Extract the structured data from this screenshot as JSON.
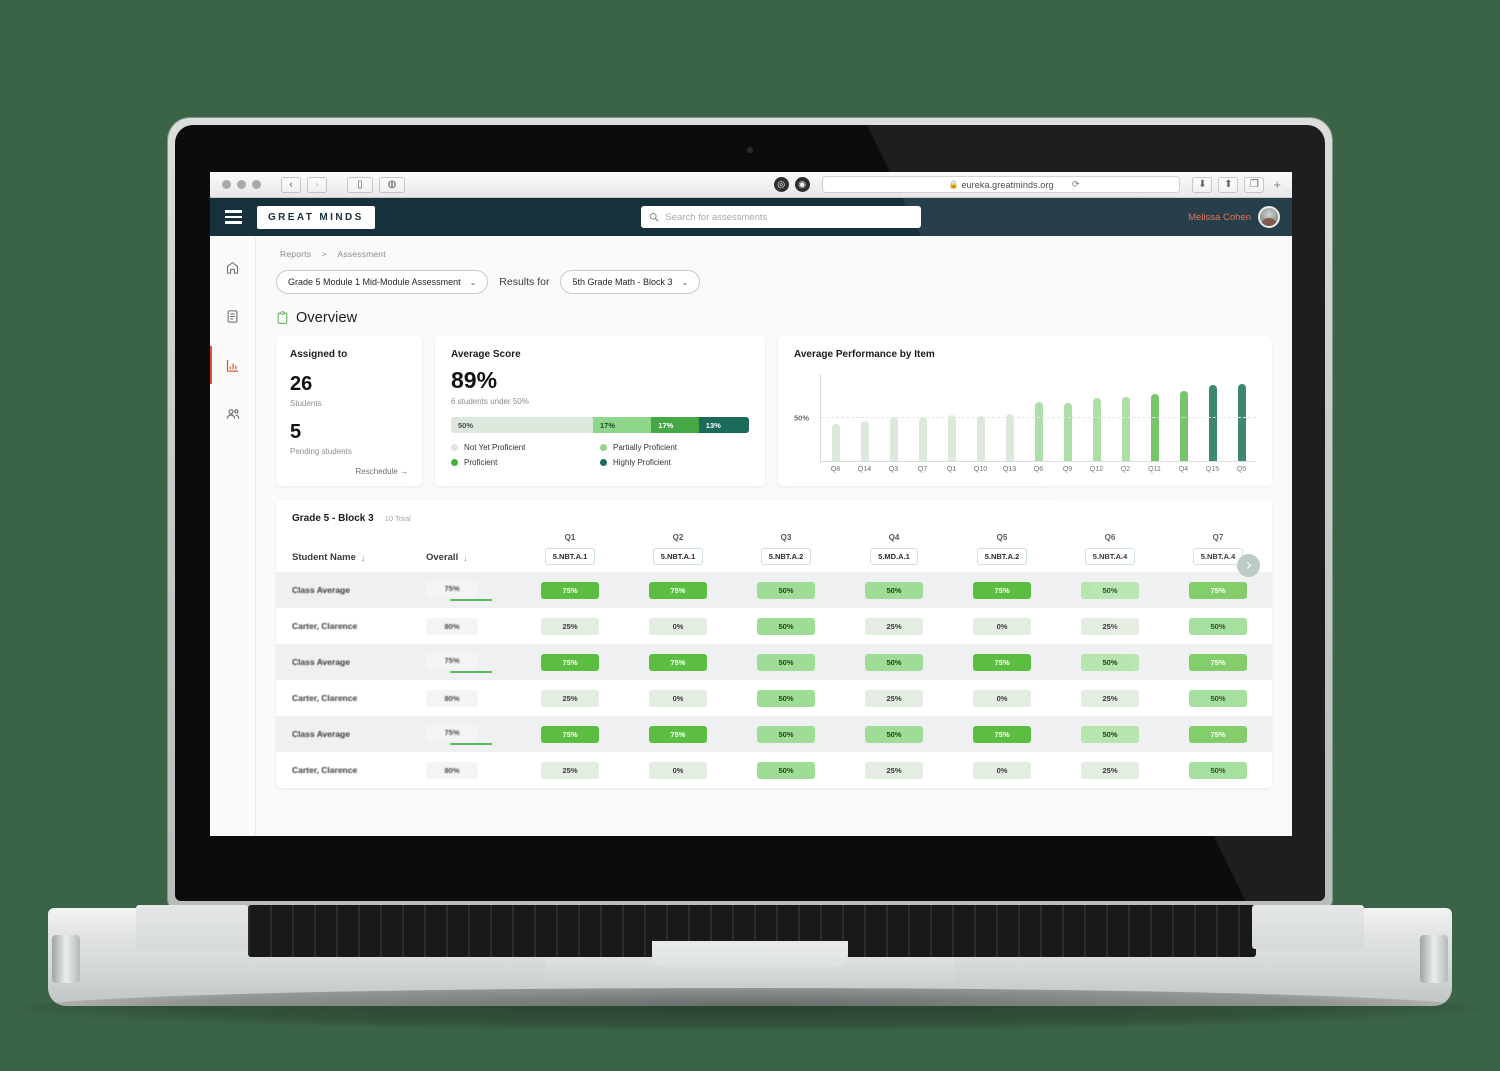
{
  "browser": {
    "url": "eureka.greatminds.org",
    "lock_icon": "lock-icon",
    "back_icon": "chevron-left-icon",
    "forward_icon": "chevron-right-icon",
    "sidebar_icon": "sidebar-toggle-icon",
    "compass_icon": "compass-icon",
    "reload_icon": "reload-icon",
    "download_icon": "download-icon",
    "share_icon": "share-icon",
    "tabs_icon": "tabs-icon",
    "new_tab_icon": "plus-icon"
  },
  "header": {
    "logo": "GREAT MINDS",
    "menu_icon": "hamburger-icon",
    "search": {
      "placeholder": "Search for assessments",
      "value": "",
      "icon": "search-icon"
    },
    "user_name": "Melissa Cohen"
  },
  "sidebar": {
    "items": [
      {
        "name": "home",
        "icon": "home-icon",
        "active": false
      },
      {
        "name": "reports",
        "icon": "document-icon",
        "active": false
      },
      {
        "name": "analytics",
        "icon": "bar-chart-icon",
        "active": true
      },
      {
        "name": "students",
        "icon": "people-icon",
        "active": false
      }
    ]
  },
  "breadcrumb": {
    "root": "Reports",
    "separator": ">",
    "current": "Assessment"
  },
  "filters": {
    "assessment": "Grade 5 Module 1 Mid-Module Assessment",
    "results_for_label": "Results for",
    "class": "5th Grade Math - Block 3",
    "chevron_icon": "chevron-down-icon"
  },
  "overview": {
    "icon": "clipboard-icon",
    "title": "Overview",
    "assigned": {
      "title": "Assigned to",
      "students_count": "26",
      "students_label": "Students",
      "pending_count": "5",
      "pending_label": "Pending students",
      "reschedule": "Reschedule →"
    },
    "average_score": {
      "title": "Average Score",
      "value": "89%",
      "subtitle": "6 students under 50%",
      "segments": [
        {
          "label": "50%",
          "pct": 50,
          "color": "#dde8dc",
          "text_color": "#4a4a4a"
        },
        {
          "label": "17%",
          "pct": 19,
          "color": "#8ed68a",
          "text_color": "#1f4a23"
        },
        {
          "label": "17%",
          "pct": 15,
          "color": "#45a845",
          "text_color": "#ffffff"
        },
        {
          "label": "13%",
          "pct": 16,
          "color": "#1a6b5c",
          "text_color": "#ffffff"
        }
      ],
      "legend": [
        {
          "label": "Not Yet Proficient",
          "color": "#dde8dc"
        },
        {
          "label": "Partially Proficient",
          "color": "#8ed68a"
        },
        {
          "label": "Proficient",
          "color": "#45b03c"
        },
        {
          "label": "Highly Proficient",
          "color": "#1a6b5c"
        }
      ]
    }
  },
  "chart_data": {
    "type": "bar",
    "title": "Average Performance by Item",
    "xlabel": "",
    "ylabel": "",
    "ylim": [
      0,
      100
    ],
    "grid": true,
    "gridlines": [
      50
    ],
    "ytick_labels": [
      "50%"
    ],
    "legend": "none",
    "categories": [
      "Q8",
      "Q14",
      "Q3",
      "Q7",
      "Q1",
      "Q10",
      "Q13",
      "Q6",
      "Q9",
      "Q12",
      "Q2",
      "Q11",
      "Q4",
      "Q15",
      "Q5"
    ],
    "values": [
      43,
      46,
      51,
      51,
      53,
      52,
      54,
      68,
      67,
      73,
      74,
      77,
      81,
      87,
      89
    ],
    "bar_colors": [
      "#dde8dc",
      "#dde8dc",
      "#dde8dc",
      "#dde8dc",
      "#dde8dc",
      "#dde8dc",
      "#dde8dc",
      "#a7dba1",
      "#a7dba1",
      "#a7dba1",
      "#a7dba1",
      "#6cc05f",
      "#6cc05f",
      "#2e7d68",
      "#2e7d68"
    ]
  },
  "table": {
    "title": "Grade 5 - Block 3",
    "total": "10 Total",
    "scroll_right_icon": "chevron-right-icon",
    "headers": {
      "student_name": "Student Name",
      "overall": "Overall",
      "sort_icon": "arrow-down-icon"
    },
    "columns": [
      {
        "q": "Q1",
        "standard": "5.NBT.A.1"
      },
      {
        "q": "Q2",
        "standard": "5.NBT.A.1"
      },
      {
        "q": "Q3",
        "standard": "5.NBT.A.2"
      },
      {
        "q": "Q4",
        "standard": "5.MD.A.1"
      },
      {
        "q": "Q5",
        "standard": "5.NBT.A.2"
      },
      {
        "q": "Q6",
        "standard": "5.NBT.A.4"
      },
      {
        "q": "Q7",
        "standard": "5.NBT.A.4"
      }
    ],
    "rows": [
      {
        "name": "Class Average",
        "type": "average",
        "overall": "75%",
        "scores": [
          {
            "value": "75%",
            "bg": "#5cbe41",
            "fg": "#ffffff"
          },
          {
            "value": "75%",
            "bg": "#5cbe41",
            "fg": "#ffffff"
          },
          {
            "value": "50%",
            "bg": "#9fdd97",
            "fg": "#27401f"
          },
          {
            "value": "50%",
            "bg": "#9fdd97",
            "fg": "#27401f"
          },
          {
            "value": "75%",
            "bg": "#5cbe41",
            "fg": "#ffffff"
          },
          {
            "value": "50%",
            "bg": "#b6e5ae",
            "fg": "#27401f"
          },
          {
            "value": "75%",
            "bg": "#7ac95f",
            "fg": "#ffffff"
          }
        ]
      },
      {
        "name": "Carter, Clarence",
        "type": "student",
        "overall": "80%",
        "scores": [
          {
            "value": "25%",
            "bg": "#e4ede2",
            "fg": "#3c3c3c"
          },
          {
            "value": "0%",
            "bg": "#e4ede2",
            "fg": "#3c3c3c"
          },
          {
            "value": "50%",
            "bg": "#9fdd97",
            "fg": "#27401f"
          },
          {
            "value": "25%",
            "bg": "#e4ede2",
            "fg": "#3c3c3c"
          },
          {
            "value": "0%",
            "bg": "#e4ede2",
            "fg": "#3c3c3c"
          },
          {
            "value": "25%",
            "bg": "#e4ede2",
            "fg": "#3c3c3c"
          },
          {
            "value": "50%",
            "bg": "#9fdd97",
            "fg": "#27401f"
          }
        ]
      },
      {
        "name": "Class Average",
        "type": "average",
        "overall": "75%",
        "scores": [
          {
            "value": "75%",
            "bg": "#5cbe41",
            "fg": "#ffffff"
          },
          {
            "value": "75%",
            "bg": "#5cbe41",
            "fg": "#ffffff"
          },
          {
            "value": "50%",
            "bg": "#9fdd97",
            "fg": "#27401f"
          },
          {
            "value": "50%",
            "bg": "#9fdd97",
            "fg": "#27401f"
          },
          {
            "value": "75%",
            "bg": "#5cbe41",
            "fg": "#ffffff"
          },
          {
            "value": "50%",
            "bg": "#b6e5ae",
            "fg": "#27401f"
          },
          {
            "value": "75%",
            "bg": "#7ac95f",
            "fg": "#ffffff"
          }
        ]
      },
      {
        "name": "Carter, Clarence",
        "type": "student",
        "overall": "80%",
        "scores": [
          {
            "value": "25%",
            "bg": "#e4ede2",
            "fg": "#3c3c3c"
          },
          {
            "value": "0%",
            "bg": "#e4ede2",
            "fg": "#3c3c3c"
          },
          {
            "value": "50%",
            "bg": "#9fdd97",
            "fg": "#27401f"
          },
          {
            "value": "25%",
            "bg": "#e4ede2",
            "fg": "#3c3c3c"
          },
          {
            "value": "0%",
            "bg": "#e4ede2",
            "fg": "#3c3c3c"
          },
          {
            "value": "25%",
            "bg": "#e4ede2",
            "fg": "#3c3c3c"
          },
          {
            "value": "50%",
            "bg": "#9fdd97",
            "fg": "#27401f"
          }
        ]
      },
      {
        "name": "Class Average",
        "type": "average",
        "overall": "75%",
        "scores": [
          {
            "value": "75%",
            "bg": "#5cbe41",
            "fg": "#ffffff"
          },
          {
            "value": "75%",
            "bg": "#5cbe41",
            "fg": "#ffffff"
          },
          {
            "value": "50%",
            "bg": "#9fdd97",
            "fg": "#27401f"
          },
          {
            "value": "50%",
            "bg": "#9fdd97",
            "fg": "#27401f"
          },
          {
            "value": "75%",
            "bg": "#5cbe41",
            "fg": "#ffffff"
          },
          {
            "value": "50%",
            "bg": "#b6e5ae",
            "fg": "#27401f"
          },
          {
            "value": "75%",
            "bg": "#7ac95f",
            "fg": "#ffffff"
          }
        ]
      },
      {
        "name": "Carter, Clarence",
        "type": "student",
        "overall": "80%",
        "scores": [
          {
            "value": "25%",
            "bg": "#e4ede2",
            "fg": "#3c3c3c"
          },
          {
            "value": "0%",
            "bg": "#e4ede2",
            "fg": "#3c3c3c"
          },
          {
            "value": "50%",
            "bg": "#9fdd97",
            "fg": "#27401f"
          },
          {
            "value": "25%",
            "bg": "#e4ede2",
            "fg": "#3c3c3c"
          },
          {
            "value": "0%",
            "bg": "#e4ede2",
            "fg": "#3c3c3c"
          },
          {
            "value": "25%",
            "bg": "#e4ede2",
            "fg": "#3c3c3c"
          },
          {
            "value": "50%",
            "bg": "#9fdd97",
            "fg": "#27401f"
          }
        ]
      }
    ]
  },
  "colors": {
    "page_background": "#3b6346",
    "app_header": "#16303c",
    "accent_red": "#e2512e",
    "accent_green": "#45b03c"
  }
}
